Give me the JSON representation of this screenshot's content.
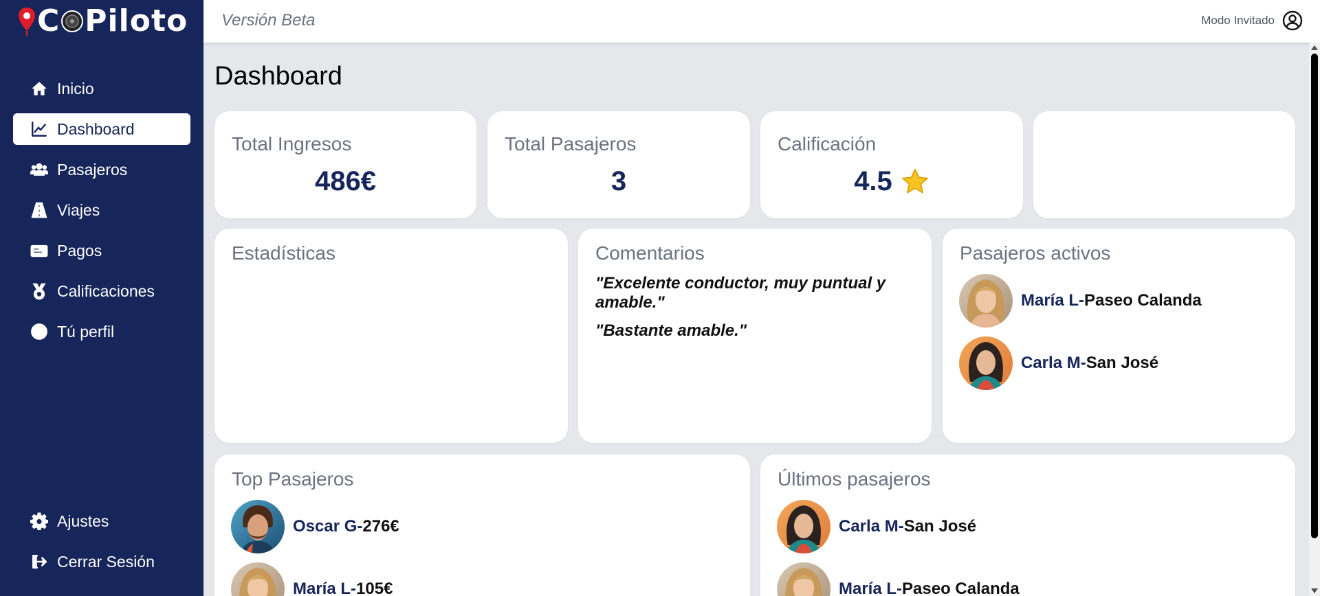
{
  "app": {
    "logo_text_pre": "C",
    "logo_text_post": "Piloto"
  },
  "header": {
    "beta_label": "Versión Beta",
    "mode_label": "Modo Invitado"
  },
  "sidebar": {
    "items": [
      {
        "label": "Inicio",
        "icon": "home-icon"
      },
      {
        "label": "Dashboard",
        "icon": "chart-line-icon",
        "active": true
      },
      {
        "label": "Pasajeros",
        "icon": "users-icon"
      },
      {
        "label": "Viajes",
        "icon": "road-icon"
      },
      {
        "label": "Pagos",
        "icon": "id-card-icon"
      },
      {
        "label": "Calificaciones",
        "icon": "medal-icon"
      },
      {
        "label": "Tú perfil",
        "icon": "user-circle-icon"
      }
    ],
    "bottom_items": [
      {
        "label": "Ajustes",
        "icon": "gear-icon"
      },
      {
        "label": "Cerrar Sesión",
        "icon": "sign-out-icon"
      }
    ]
  },
  "page": {
    "title": "Dashboard"
  },
  "stats": [
    {
      "title": "Total Ingresos",
      "value": "486€"
    },
    {
      "title": "Total Pasajeros",
      "value": "3"
    },
    {
      "title": "Calificación",
      "value": "4.5",
      "icon": "star-icon"
    }
  ],
  "panels": {
    "estadisticas_title": "Estadísticas",
    "comentarios_title": "Comentarios",
    "comentarios": [
      "\"Excelente conductor, muy puntual y amable.\"",
      "\"Bastante amable.\""
    ],
    "activos_title": "Pasajeros activos",
    "activos": [
      {
        "name": "María L",
        "sep": " - ",
        "detail": "Paseo Calanda"
      },
      {
        "name": "Carla M",
        "sep": " - ",
        "detail": "San José"
      }
    ],
    "top_title": "Top Pasajeros",
    "top": [
      {
        "name": "Oscar G",
        "sep": " - ",
        "detail": "276€"
      },
      {
        "name": "María L",
        "sep": " - ",
        "detail": "105€"
      }
    ],
    "ultimos_title": "Últimos pasajeros",
    "ultimos": [
      {
        "name": "Carla M",
        "sep": " - ",
        "detail": "San José"
      },
      {
        "name": "María L",
        "sep": " - ",
        "detail": "Paseo Calanda"
      }
    ]
  },
  "colors": {
    "sidebar_bg": "#16255a",
    "accent": "#16255a",
    "background": "#e5e7eb",
    "logo_pin": "#e11d2a"
  }
}
